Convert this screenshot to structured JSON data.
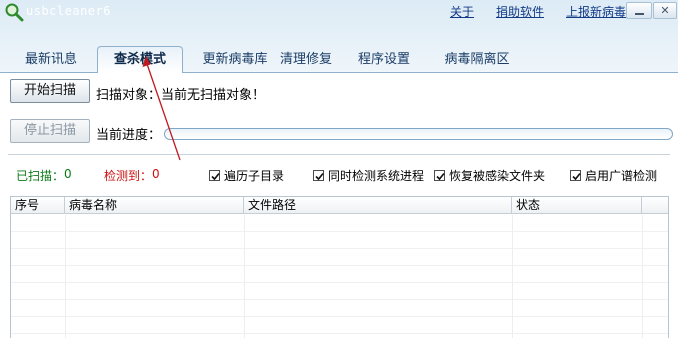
{
  "window": {
    "title": "usbcleaner6",
    "links": [
      "关于",
      "捐助软件",
      "上报新病毒"
    ],
    "close_glyph": "✕"
  },
  "tabs": [
    {
      "label": "最新讯息",
      "active": false
    },
    {
      "label": "查杀模式",
      "active": true
    },
    {
      "label": "更新病毒库",
      "active": false
    },
    {
      "label": "清理修复",
      "active": false
    },
    {
      "label": "程序设置",
      "active": false
    },
    {
      "label": "病毒隔离区",
      "active": false
    }
  ],
  "scan": {
    "start_button": "开始扫描",
    "stop_button": "停止扫描",
    "target_label": "扫描对象：",
    "target_value": "当前无扫描对象！",
    "progress_label": "当前进度：",
    "progress": 0
  },
  "stats": {
    "scanned_label": "已扫描：",
    "scanned_value": "0",
    "detected_label": "检测到：",
    "detected_value": "0"
  },
  "options": [
    {
      "label": "遍历子目录",
      "checked": true
    },
    {
      "label": "同时检测系统进程",
      "checked": true
    },
    {
      "label": "恢复被感染文件夹",
      "checked": true
    },
    {
      "label": "启用广谱检测",
      "checked": true
    }
  ],
  "table": {
    "columns": [
      "序号",
      "病毒名称",
      "文件路径",
      "状态"
    ],
    "rows": []
  },
  "icons": {
    "app": "magnifier-icon",
    "checkbox": "checkmark-icon"
  },
  "colors": {
    "scanned": "#0a7a16",
    "detected": "#cc1010",
    "link": "#123a86",
    "annotation_arrow": "#c0181e"
  }
}
